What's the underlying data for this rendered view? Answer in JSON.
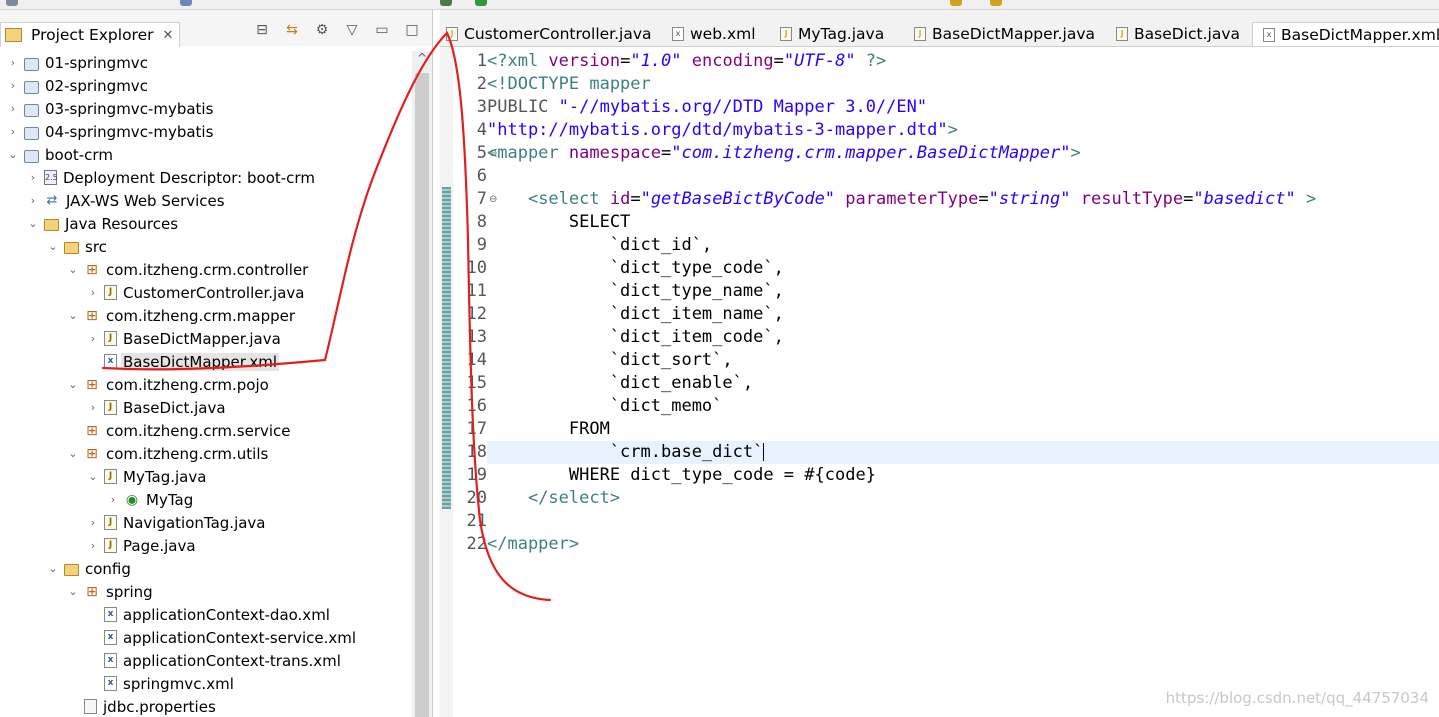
{
  "explorer": {
    "title": "Project Explorer",
    "close_glyph": "✕",
    "tree": [
      {
        "label": "01-springmvc",
        "icon": "project-icon",
        "depth": 0,
        "arrow": "›"
      },
      {
        "label": "02-springmvc",
        "icon": "project-icon",
        "depth": 0,
        "arrow": "›"
      },
      {
        "label": "03-springmvc-mybatis",
        "icon": "project-icon",
        "depth": 0,
        "arrow": "›"
      },
      {
        "label": "04-springmvc-mybatis",
        "icon": "project-icon",
        "depth": 0,
        "arrow": "›"
      },
      {
        "label": "boot-crm",
        "icon": "project-icon",
        "depth": 0,
        "arrow": "⌄"
      },
      {
        "label": "Deployment Descriptor: boot-crm",
        "icon": "descriptor-icon",
        "depth": 1,
        "arrow": "›"
      },
      {
        "label": "JAX-WS Web Services",
        "icon": "webservice-icon",
        "depth": 1,
        "arrow": "›"
      },
      {
        "label": "Java Resources",
        "icon": "java-resources-icon",
        "depth": 1,
        "arrow": "⌄"
      },
      {
        "label": "src",
        "icon": "source-folder-icon",
        "depth": 2,
        "arrow": "⌄"
      },
      {
        "label": "com.itzheng.crm.controller",
        "icon": "package-icon",
        "depth": 3,
        "arrow": "⌄"
      },
      {
        "label": "CustomerController.java",
        "icon": "java-file-icon",
        "depth": 4,
        "arrow": "›"
      },
      {
        "label": "com.itzheng.crm.mapper",
        "icon": "package-icon",
        "depth": 3,
        "arrow": "⌄"
      },
      {
        "label": "BaseDictMapper.java",
        "icon": "java-file-icon",
        "depth": 4,
        "arrow": "›"
      },
      {
        "label": "BaseDictMapper.xml",
        "icon": "xml-file-icon",
        "depth": 4,
        "arrow": "",
        "selected": true
      },
      {
        "label": "com.itzheng.crm.pojo",
        "icon": "package-icon",
        "depth": 3,
        "arrow": "⌄"
      },
      {
        "label": "BaseDict.java",
        "icon": "java-file-icon",
        "depth": 4,
        "arrow": "›"
      },
      {
        "label": "com.itzheng.crm.service",
        "icon": "package-icon",
        "depth": 3,
        "arrow": ""
      },
      {
        "label": "com.itzheng.crm.utils",
        "icon": "package-icon",
        "depth": 3,
        "arrow": "⌄"
      },
      {
        "label": "MyTag.java",
        "icon": "java-file-icon",
        "depth": 4,
        "arrow": "⌄"
      },
      {
        "label": "MyTag",
        "icon": "class-icon",
        "depth": 5,
        "arrow": "›"
      },
      {
        "label": "NavigationTag.java",
        "icon": "java-file-icon",
        "depth": 4,
        "arrow": "›"
      },
      {
        "label": "Page.java",
        "icon": "java-file-icon",
        "depth": 4,
        "arrow": "›"
      },
      {
        "label": "config",
        "icon": "source-folder-icon",
        "depth": 2,
        "arrow": "⌄"
      },
      {
        "label": "spring",
        "icon": "package-icon",
        "depth": 3,
        "arrow": "⌄"
      },
      {
        "label": "applicationContext-dao.xml",
        "icon": "xml-file-icon",
        "depth": 4,
        "arrow": ""
      },
      {
        "label": "applicationContext-service.xml",
        "icon": "xml-file-icon",
        "depth": 4,
        "arrow": ""
      },
      {
        "label": "applicationContext-trans.xml",
        "icon": "xml-file-icon",
        "depth": 4,
        "arrow": ""
      },
      {
        "label": "springmvc.xml",
        "icon": "xml-file-icon",
        "depth": 4,
        "arrow": ""
      },
      {
        "label": "jdbc.properties",
        "icon": "properties-file-icon",
        "depth": 3,
        "arrow": ""
      }
    ]
  },
  "editor": {
    "tabs": [
      {
        "label": "CustomerController.java",
        "icon": "java-file-icon",
        "active": false
      },
      {
        "label": "web.xml",
        "icon": "xml-file-icon",
        "active": false
      },
      {
        "label": "MyTag.java",
        "icon": "java-file-icon",
        "active": false
      },
      {
        "label": "BaseDictMapper.java",
        "icon": "java-file-icon",
        "active": false
      },
      {
        "label": "BaseDict.java",
        "icon": "java-file-icon",
        "active": false
      },
      {
        "label": "BaseDictMapper.xml",
        "icon": "xml-file-icon",
        "active": true
      }
    ],
    "lines": [
      {
        "n": "1",
        "fold": "",
        "segs": [
          [
            "t-tag",
            "<?xml "
          ],
          [
            "t-attr",
            "version"
          ],
          [
            "t-plain",
            "="
          ],
          [
            "t-str",
            "\"1.0\""
          ],
          [
            "t-plain",
            " "
          ],
          [
            "t-attr",
            "encoding"
          ],
          [
            "t-plain",
            "="
          ],
          [
            "t-str",
            "\"UTF-8\""
          ],
          [
            "t-tag",
            " ?>"
          ]
        ]
      },
      {
        "n": "2",
        "fold": "",
        "segs": [
          [
            "t-tag",
            "<!DOCTYPE mapper"
          ]
        ]
      },
      {
        "n": "3",
        "fold": "",
        "segs": [
          [
            "t-gray",
            "PUBLIC "
          ],
          [
            "t-str2",
            "\"-//mybatis.org//DTD Mapper 3.0//EN\""
          ]
        ]
      },
      {
        "n": "4",
        "fold": "",
        "segs": [
          [
            "t-str2",
            "\"http://mybatis.org/dtd/mybatis-3-mapper.dtd\""
          ],
          [
            "t-tag",
            ">"
          ]
        ]
      },
      {
        "n": "5",
        "fold": "⊖",
        "segs": [
          [
            "t-tag",
            "<mapper "
          ],
          [
            "t-attr",
            "namespace"
          ],
          [
            "t-plain",
            "="
          ],
          [
            "t-str",
            "\"com.itzheng.crm.mapper.BaseDictMapper\""
          ],
          [
            "t-tag",
            ">"
          ]
        ]
      },
      {
        "n": "6",
        "fold": "",
        "segs": [
          [
            "t-plain",
            ""
          ]
        ]
      },
      {
        "n": "7",
        "fold": "⊖",
        "segs": [
          [
            "t-plain",
            "    "
          ],
          [
            "t-tag",
            "<select "
          ],
          [
            "t-attr",
            "id"
          ],
          [
            "t-plain",
            "="
          ],
          [
            "t-str",
            "\"getBaseBictByCode\""
          ],
          [
            "t-plain",
            " "
          ],
          [
            "t-attr",
            "parameterType"
          ],
          [
            "t-plain",
            "="
          ],
          [
            "t-str",
            "\"string\""
          ],
          [
            "t-plain",
            " "
          ],
          [
            "t-attr",
            "resultType"
          ],
          [
            "t-plain",
            "="
          ],
          [
            "t-str",
            "\"basedict\""
          ],
          [
            "t-tag",
            " >"
          ]
        ]
      },
      {
        "n": "8",
        "fold": "",
        "segs": [
          [
            "t-plain",
            "        SELECT"
          ]
        ]
      },
      {
        "n": "9",
        "fold": "",
        "segs": [
          [
            "t-plain",
            "            `dict_id`,"
          ]
        ]
      },
      {
        "n": "10",
        "fold": "",
        "segs": [
          [
            "t-plain",
            "            `dict_type_code`,"
          ]
        ]
      },
      {
        "n": "11",
        "fold": "",
        "segs": [
          [
            "t-plain",
            "            `dict_type_name`,"
          ]
        ]
      },
      {
        "n": "12",
        "fold": "",
        "segs": [
          [
            "t-plain",
            "            `dict_item_name`,"
          ]
        ]
      },
      {
        "n": "13",
        "fold": "",
        "segs": [
          [
            "t-plain",
            "            `dict_item_code`,"
          ]
        ]
      },
      {
        "n": "14",
        "fold": "",
        "segs": [
          [
            "t-plain",
            "            `dict_sort`,"
          ]
        ]
      },
      {
        "n": "15",
        "fold": "",
        "segs": [
          [
            "t-plain",
            "            `dict_enable`,"
          ]
        ]
      },
      {
        "n": "16",
        "fold": "",
        "segs": [
          [
            "t-plain",
            "            `dict_memo`"
          ]
        ]
      },
      {
        "n": "17",
        "fold": "",
        "segs": [
          [
            "t-plain",
            "        FROM"
          ]
        ]
      },
      {
        "n": "18",
        "fold": "",
        "current": true,
        "segs": [
          [
            "t-plain",
            "            `crm.base_dict`"
          ]
        ]
      },
      {
        "n": "19",
        "fold": "",
        "segs": [
          [
            "t-plain",
            "        WHERE dict_type_code = #{code}"
          ]
        ]
      },
      {
        "n": "20",
        "fold": "",
        "segs": [
          [
            "t-plain",
            "    "
          ],
          [
            "t-tag",
            "</select>"
          ]
        ]
      },
      {
        "n": "21",
        "fold": "",
        "segs": [
          [
            "t-plain",
            ""
          ]
        ]
      },
      {
        "n": "22",
        "fold": "",
        "segs": [
          [
            "t-tag",
            "</mapper>"
          ]
        ]
      }
    ]
  },
  "watermark": "https://blog.csdn.net/qq_44757034",
  "colors": {
    "annotation": "#e02020",
    "tag": "#3f7f7f",
    "attribute": "#7f007f",
    "string": "#2a00ff"
  }
}
